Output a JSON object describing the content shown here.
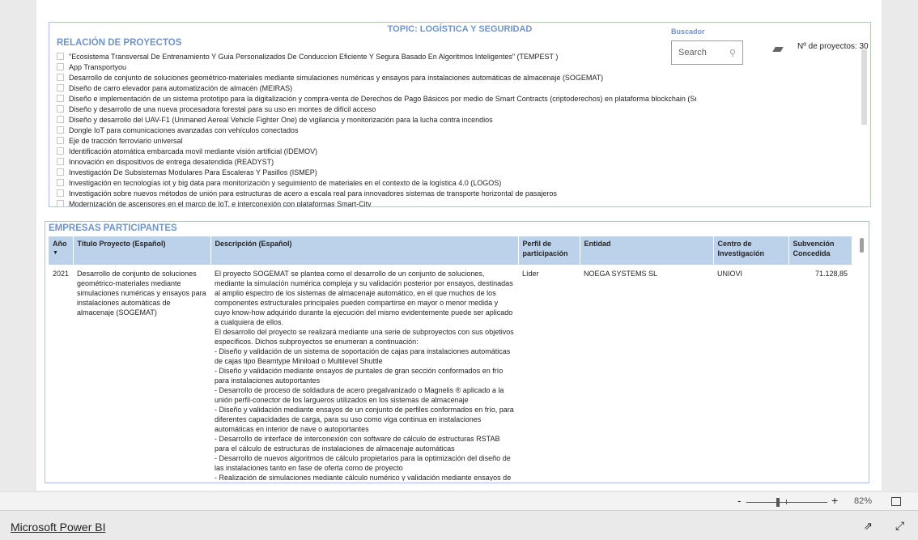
{
  "topic": "TOPIC: LOGÍSTICA Y SEGURIDAD",
  "projects": {
    "title": "RELACIÓN DE PROYECTOS",
    "items": [
      "\"Ecosistema Transversal De Entrenamiento Y Guia Personalizados De Conduccion Eficiente Y Segura Basado En Algoritmos Inteligentes\" (TEMPEST )",
      "App Transportyou",
      "Desarrollo de conjunto de soluciones geométrico-materiales mediante simulaciones numéricas y ensayos para instalaciones automáticas de almacenaje (SOGEMAT)",
      "Diseño de carro elevador para automatización de almacén (MEIRAS)",
      "Diseño e implementación de un sistema prototipo para la digitalización y compra-venta de Derechos de Pago Básicos por medio de Smart Contracts (criptoderechos) en plataforma blockchain (SmartDPB)",
      "Diseño y desarrollo de una nueva procesadora forestal para su uso en montes de difícil acceso",
      "Diseño y desarrollo del UAV-F1 (Unmaned Aereal Vehicle Fighter One) de vigilancia y monitorización para la lucha contra incendios",
      "Dongle IoT para comunicaciones avanzadas con vehículos conectados",
      "Eje de tracción ferroviario universal",
      "Identificación atomática embarcada movil mediante visión artificial (IDEMOV)",
      "Innovación en dispositivos de entrega desatendida (READYST)",
      "Investigación De Subsistemas Modulares Para Escaleras Y Pasillos (ISMEP)",
      "Investigación en tecnologías iot y big data para monitorización y seguimiento de materiales en el contexto de la logística 4.0 (LOGOS)",
      "Investigación sobre nuevos métodos de unión para estructuras de acero a escala real para innovadores sistemas de transporte horizontal de pasajeros",
      "Modernización de ascensores en el marco de IoT, e interconexión con plataformas Smart-City"
    ]
  },
  "search": {
    "label": "Buscador",
    "placeholder": "Search"
  },
  "count": "Nº de proyectos: 30",
  "companies": {
    "title": "EMPRESAS PARTICIPANTES",
    "headers": [
      "Año",
      "Título Proyecto (Español)",
      "Descripción (Español)",
      "Perfil de participación",
      "Entidad",
      "Centro de Investigación",
      "Subvención Concedida"
    ],
    "row": {
      "year": "2021",
      "title": "Desarrollo de conjunto de soluciones geométrico-materiales mediante simulaciones numéricas y ensayos para instalaciones automáticas de almacenaje (SOGEMAT)",
      "description": "El proyecto SOGEMAT se plantea como el desarrollo de un conjunto de soluciones, mediante la simulación numérica compleja y su validación posterior por ensayos, destinadas al amplio espectro de los sistemas de almacenaje automático, en el que muchos de los componentes estructurales principales pueden compartirse en mayor o menor medida y cuyo know-how adquirido durante la ejecución del mismo evidentemente puede ser aplicado a cualquiera de ellos.\nEl desarrollo del proyecto se realizará mediante una serie de subproyectos con sus objetivos específicos. Dichos subproyectos se enumeran a continuación:\n- Diseño y validación de un sistema de soportación de cajas para instalaciones automáticas de cajas tipo Beamtype Miniload o Multilevel Shuttle\n- Diseño y validación mediante ensayos de puntales de gran sección conformados en frío para instalaciones autoportantes\n- Desarrollo de proceso de soldadura de acero pregalvanizado o Magnelis ® aplicado a la unión perfil-conector de los largueros utilizados en los sistemas de almacenaje\n- Diseño y validación mediante ensayos de un conjunto de perfiles conformados en frío, para diferentes capacidades de carga, para su uso como viga continua en instalaciones automáticas en interior de nave o autoportantes\n- Desarrollo de interface de interconexión con software de cálculo de estructuras RSTAB para el cálculo de estructuras de instalaciones de almacenaje automáticas\n- Desarrollo de nuevos algoritmos de cálculo propietarios para la optimización del diseño de las instalaciones tanto en fase de oferta como de proyecto\n- Realización de simulaciones mediante cálculo numérico y validación mediante ensayos de",
      "profile": "Líder",
      "entity": "NOEGA SYSTEMS SL",
      "center": "UNIOVI",
      "grant": "71.128,85"
    }
  },
  "zoom": {
    "minus": "-",
    "plus": "+",
    "level": "82%",
    "value": 82
  },
  "footer": {
    "brand": "Microsoft Power BI"
  }
}
